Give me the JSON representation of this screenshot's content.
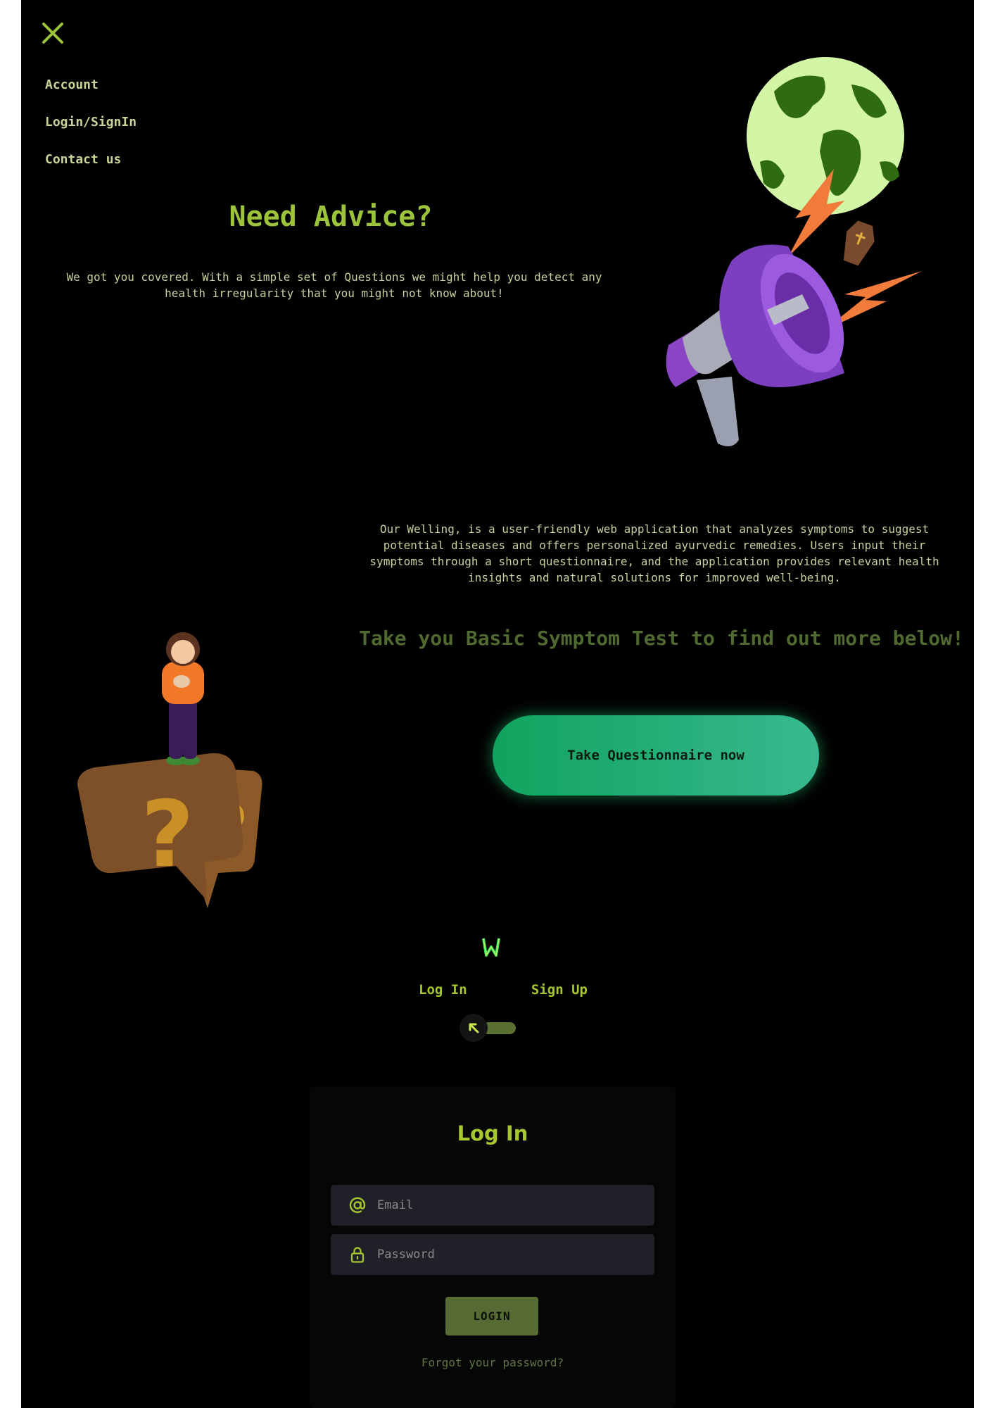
{
  "nav": {
    "items": [
      "Account",
      "Login/SignIn",
      "Contact us"
    ]
  },
  "hero": {
    "title": "Need Advice?",
    "text": "We got you covered. With a simple set of Questions we might help you detect any health irregularity that you might not know about!"
  },
  "about": {
    "text": "Our Welling, is a user-friendly web application that analyzes symptoms to suggest potential diseases and offers personalized ayurvedic remedies. Users input their symptoms through a short questionnaire, and the application provides relevant health insights and natural solutions for improved well-being.",
    "cta_text": "Take you Basic Symptom Test to find out more below!",
    "button_label": "Take Questionnaire now"
  },
  "auth": {
    "tab_login": "Log In",
    "tab_signup": "Sign Up",
    "card_title": "Log In",
    "email_placeholder": "Email",
    "password_placeholder": "Password",
    "login_button": "LOGIN",
    "forgot_link": "Forgot your password?"
  },
  "colors": {
    "background": "#000000",
    "accent_green": "#a6c730",
    "button_gradient_start": "#10a35e",
    "button_gradient_end": "#38b990",
    "muted_text": "#c9cf9e"
  },
  "icons": [
    "close-icon",
    "globe-illustration",
    "megaphone-illustration",
    "person-question-illustration",
    "app-logo",
    "arrow-up-left-icon",
    "at-sign-icon",
    "lock-icon"
  ]
}
